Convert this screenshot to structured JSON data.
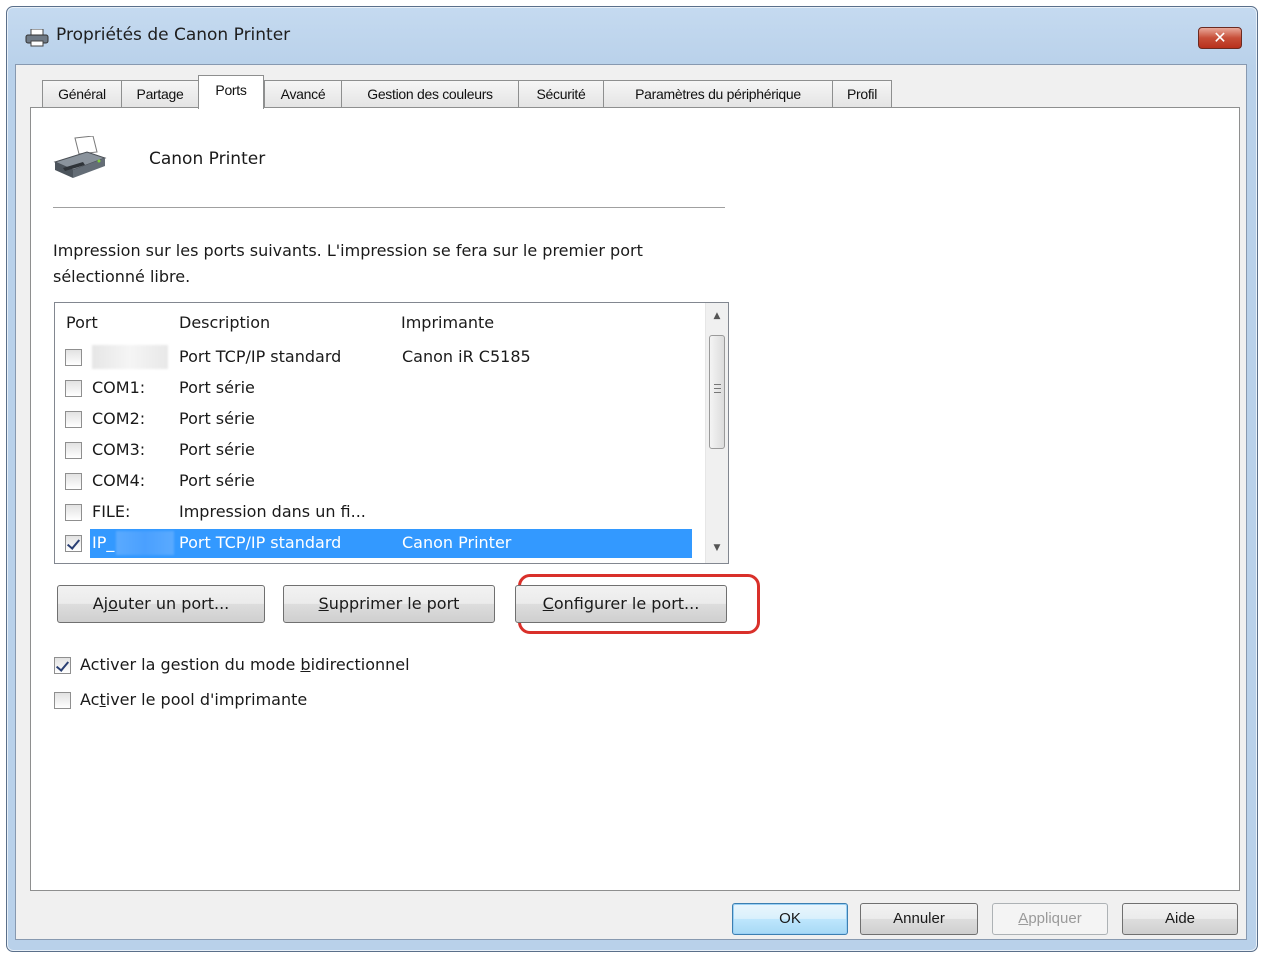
{
  "window": {
    "title": "Propriétés de Canon Printer",
    "close_glyph": "✕"
  },
  "tabs": [
    {
      "label": "Général"
    },
    {
      "label": "Partage"
    },
    {
      "label": "Ports",
      "active": true
    },
    {
      "label": "Avancé"
    },
    {
      "label": "Gestion des couleurs"
    },
    {
      "label": "Sécurité"
    },
    {
      "label": "Paramètres du périphérique"
    },
    {
      "label": "Profil"
    }
  ],
  "printer": {
    "name": "Canon Printer",
    "icon": "printer-icon"
  },
  "intro_text": "Impression sur les ports suivants. L'impression se fera sur le premier port sélectionné libre.",
  "port_list": {
    "columns": [
      "Port",
      "Description",
      "Imprimante"
    ],
    "rows": [
      {
        "port": "",
        "description": "Port TCP/IP standard",
        "printer": "Canon iR C5185",
        "checked": false,
        "selected": false
      },
      {
        "port": "COM1:",
        "description": "Port série",
        "printer": "",
        "checked": false,
        "selected": false
      },
      {
        "port": "COM2:",
        "description": "Port série",
        "printer": "",
        "checked": false,
        "selected": false
      },
      {
        "port": "COM3:",
        "description": "Port série",
        "printer": "",
        "checked": false,
        "selected": false
      },
      {
        "port": "COM4:",
        "description": "Port série",
        "printer": "",
        "checked": false,
        "selected": false
      },
      {
        "port": "FILE:",
        "description": "Impression dans un fi...",
        "printer": "",
        "checked": false,
        "selected": false
      },
      {
        "port": "IP_",
        "description": "Port TCP/IP standard",
        "printer": "Canon Printer",
        "checked": true,
        "selected": true
      }
    ]
  },
  "buttons": {
    "add_port": {
      "before": "Aj",
      "mnemonic": "o",
      "after": "uter un port..."
    },
    "delete_port": {
      "before": "",
      "mnemonic": "S",
      "after": "upprimer le port"
    },
    "configure_port": {
      "before": "",
      "mnemonic": "C",
      "after": "onfigurer le port..."
    }
  },
  "options": {
    "bidirectional": {
      "before": "Activer la gestion du mode ",
      "mnemonic": "b",
      "after": "idirectionnel",
      "checked": true
    },
    "pooling": {
      "before": "Ac",
      "mnemonic": "t",
      "after": "iver le pool d'imprimante",
      "checked": false
    }
  },
  "footer": {
    "ok": "OK",
    "cancel": "Annuler",
    "apply": {
      "mnemonic": "A",
      "after": "ppliquer"
    },
    "help": "Aide"
  },
  "colors": {
    "selection": "#3399ff",
    "highlight_ring": "#d9302a"
  }
}
